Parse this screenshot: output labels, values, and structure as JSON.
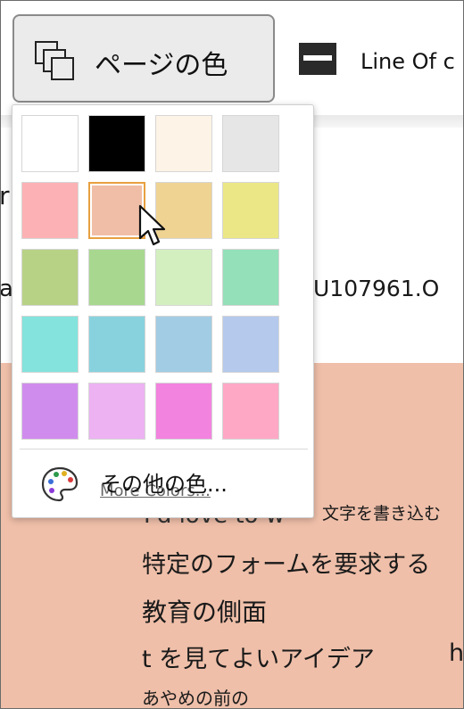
{
  "toolbar": {
    "page_color_label": "ページの色",
    "line_of_label": "Line Of c"
  },
  "background_text": {
    "line1_fragment": "r",
    "line2_fragment": "a",
    "line2_right": "U107961.O",
    "ghost_english": "I'd love to w",
    "write_text": "文字を書き込む",
    "idea1": "特定のフォームを要求する",
    "idea2": "教育の側面",
    "idea3": "t を見てよいアイデア",
    "idea3_right": "h",
    "idea4": "あやめの前の"
  },
  "page_colors": {
    "selected_index": 5,
    "swatches": [
      "#ffffff",
      "#000000",
      "#fdf3e6",
      "#e6e6e6",
      "#fcb2b4",
      "#f0bea6",
      "#efd393",
      "#ebe787",
      "#b7d285",
      "#a8d88f",
      "#d3efc0",
      "#93e0b9",
      "#84e3dc",
      "#88d2de",
      "#a2cce3",
      "#b5c9ed",
      "#d08ced",
      "#ecb2f2",
      "#f283de",
      "#fea8c6"
    ]
  },
  "more_colors": {
    "label": "その他の色...",
    "ghost_label": "More Colors..."
  },
  "icons": {
    "page_color": "page-color-icon",
    "line": "line-style-icon",
    "palette": "palette-icon",
    "cursor": "mouse-cursor-icon"
  }
}
